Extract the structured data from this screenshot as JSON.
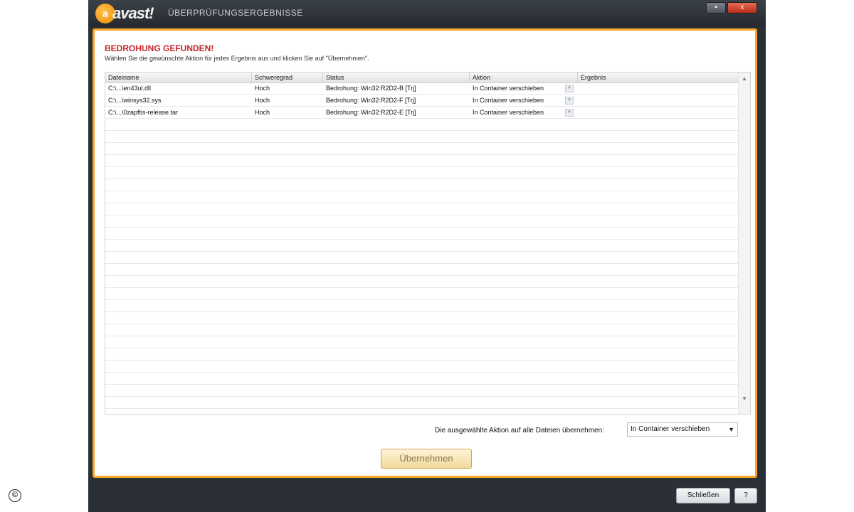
{
  "window": {
    "logo_text": "avast!",
    "title": "ÜBERPRÜFUNGSERGEBNISSE",
    "minimize_glyph": "▪",
    "close_glyph": "x"
  },
  "header": {
    "threat_title": "BEDROHUNG GEFUNDEN!",
    "instruction": "Wählen Sie die gewünschte Aktion für jedes Ergebnis aus und klicken Sie auf \"Übernehmen\"."
  },
  "table": {
    "columns": [
      "Dateiname",
      "Schweregrad",
      "Status",
      "Aktion",
      "Ergebnis"
    ],
    "rows": [
      {
        "file": "C:\\...\\en43ul.dll",
        "severity": "Hoch",
        "status": "Bedrohung: Win32:R2D2-B [Trj]",
        "action": "In Container verschieben",
        "result": ""
      },
      {
        "file": "C:\\...\\winsys32.sys",
        "severity": "Hoch",
        "status": "Bedrohung: Win32:R2D2-F [Trj]",
        "action": "In Container verschieben",
        "result": ""
      },
      {
        "file": "C:\\...\\0zapftis-release.tar",
        "severity": "Hoch",
        "status": "Bedrohung: Win32:R2D2-E [Trj]",
        "action": "In Container verschieben",
        "result": ""
      }
    ]
  },
  "apply_all": {
    "label": "Die ausgewählte Aktion auf alle Dateien übernehmen:",
    "selected": "In Container verschieben"
  },
  "buttons": {
    "apply": "Übernehmen",
    "close": "Schließen",
    "help": "?"
  },
  "icons": {
    "scroll_up": "▲",
    "scroll_down": "▼",
    "dropdown": "▼",
    "copyright": "©"
  },
  "colors": {
    "accent_orange": "#f5a623",
    "threat_red": "#c0272d",
    "titlebar": "#2b3036"
  }
}
